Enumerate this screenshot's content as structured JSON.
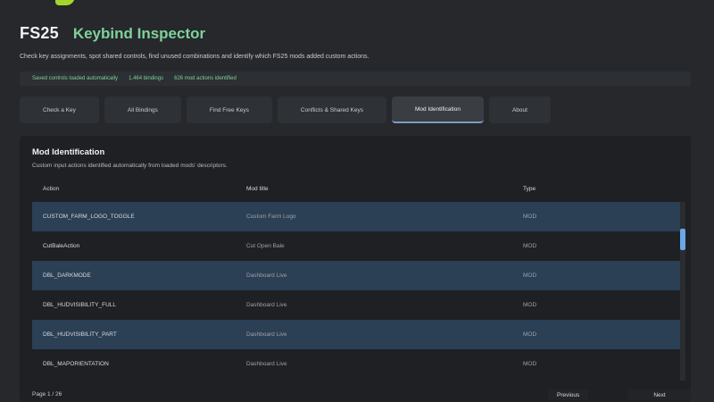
{
  "header": {
    "brand": "FS25",
    "title": "Keybind Inspector",
    "description": "Check key assignments, spot shared controls, find unused combinations and identify which FS25 mods added custom actions."
  },
  "stats": [
    "Saved controls loaded automatically",
    "1,464 bindings",
    "626 mod actions identified"
  ],
  "tabs": [
    {
      "label": "Check a Key",
      "active": false
    },
    {
      "label": "All Bindings",
      "active": false
    },
    {
      "label": "Find Free Keys",
      "active": false
    },
    {
      "label": "Conflicts & Shared Keys",
      "active": false
    },
    {
      "label": "Mod Identification",
      "active": true
    },
    {
      "label": "About",
      "active": false
    }
  ],
  "panel": {
    "title": "Mod Identification",
    "subtitle": "Custom input actions identified automatically from loaded mods' descriptors."
  },
  "table": {
    "columns": [
      "Action",
      "Mod title",
      "Type"
    ],
    "rows": [
      [
        "CUSTOM_FARM_LOGO_TOGGLE",
        "Custom Farm Logo",
        "MOD"
      ],
      [
        "CutBaleAction",
        "Cut Open Bale",
        "MOD"
      ],
      [
        "DBL_DARKMODE",
        "Dashboard Live",
        "MOD"
      ],
      [
        "DBL_HUDVISIBILITY_FULL",
        "Dashboard Live",
        "MOD"
      ],
      [
        "DBL_HUDVISIBILITY_PART",
        "Dashboard Live",
        "MOD"
      ],
      [
        "DBL_MAPORIENTATION",
        "Dashboard Live",
        "MOD"
      ]
    ]
  },
  "pager": {
    "info": "Page 1 / 26",
    "prev_label": "Previous",
    "next_label": "Next"
  },
  "colors": {
    "accent": "#7fd29a",
    "logo": "#a6d42e",
    "row_highlight": "#2b3f55",
    "scroll_thumb": "#6aa6e8"
  }
}
